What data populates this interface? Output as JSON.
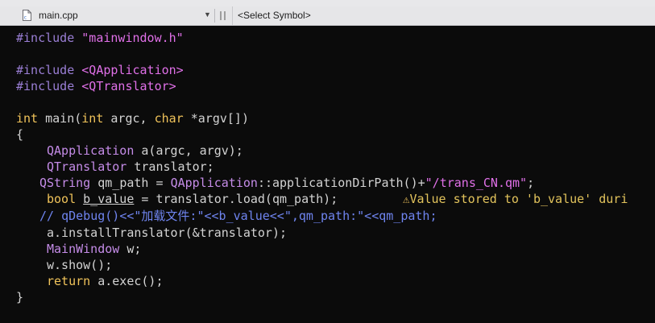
{
  "tab": {
    "file_name": "main.cpp",
    "symbol_placeholder": "<Select Symbol>"
  },
  "code": {
    "l1_pp": "#include",
    "l1_str": "\"mainwindow.h\"",
    "l3_pp": "#include",
    "l3_hdr": "<QApplication>",
    "l4_pp": "#include",
    "l4_hdr": "<QTranslator>",
    "l6_int1": "int",
    "l6_main": " main(",
    "l6_int2": "int",
    "l6_argc": " argc, ",
    "l6_char": "char",
    "l6_argv": " *argv[])",
    "l7": "{",
    "l8_cls": "QApplication",
    "l8_rest": " a(argc, argv);",
    "l9_cls": "QTranslator",
    "l9_rest": " translator;",
    "l10_cls1": "QString",
    "l10_mid1": " qm_path = ",
    "l10_cls2": "QApplication",
    "l10_mid2": "::applicationDirPath()+",
    "l10_str": "\"/trans_CN.qm\"",
    "l10_end": ";",
    "l11_kw": "bool",
    "l11_var": "b_value",
    "l11_rest": " = translator.load(qm_path);",
    "l12_comment": "// qDebug()<<\"加载文件:\"<<b_value<<\",qm_path:\"<<qm_path;",
    "l13": "a.installTranslator(&translator);",
    "l14_cls": "MainWindow",
    "l14_rest": " w;",
    "l15": "w.show();",
    "l16_kw": "return",
    "l16_rest": " a.exec();",
    "l17": "}"
  },
  "warning": {
    "icon": "warning-triangle-icon",
    "glyph": "⚠",
    "text": "Value stored to 'b_value' duri"
  },
  "colors": {
    "background": "#0b0b0b",
    "preprocessor": "#9b7fd6",
    "string": "#e070e8",
    "keyword": "#f0c35a",
    "class": "#c58ce8",
    "comment": "#6f84ef",
    "plain": "#d3d3d3",
    "warning": "#e2c35c"
  }
}
